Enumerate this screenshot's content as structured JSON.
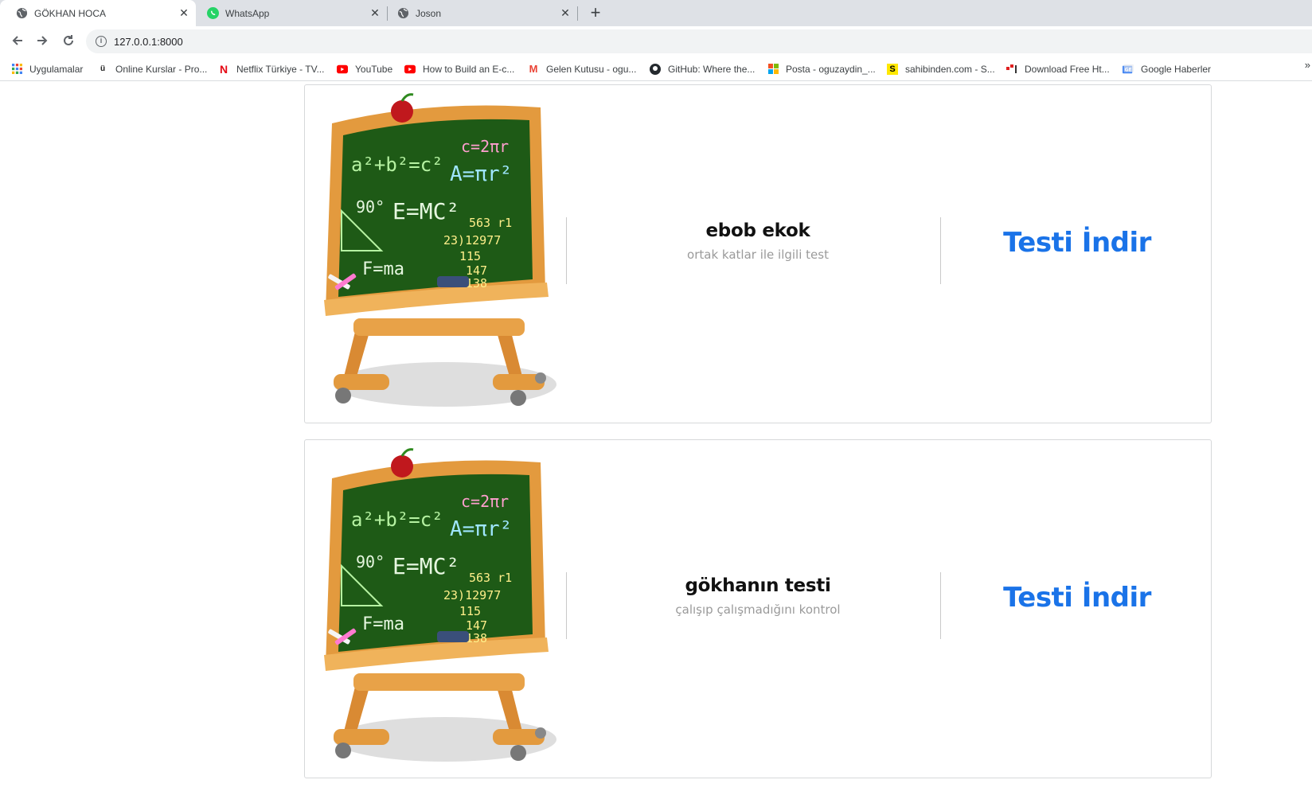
{
  "browser": {
    "tabs": [
      {
        "title": "GÖKHAN HOCA",
        "icon": "globe-icon"
      },
      {
        "title": "WhatsApp",
        "icon": "whatsapp-icon"
      },
      {
        "title": "Joson",
        "icon": "globe-icon"
      }
    ],
    "url": "127.0.0.1:8000",
    "bookmarks": [
      {
        "label": "Uygulamalar",
        "icon": "apps-grid-icon"
      },
      {
        "label": "Online Kurslar - Pro...",
        "icon": "udemy-icon"
      },
      {
        "label": "Netflix Türkiye - TV...",
        "icon": "netflix-icon"
      },
      {
        "label": "YouTube",
        "icon": "youtube-icon"
      },
      {
        "label": "How to Build an E-c...",
        "icon": "youtube-icon"
      },
      {
        "label": "Gelen Kutusu - ogu...",
        "icon": "gmail-icon"
      },
      {
        "label": "GitHub: Where the...",
        "icon": "github-icon"
      },
      {
        "label": "Posta - oguzaydin_...",
        "icon": "microsoft-icon"
      },
      {
        "label": "sahibinden.com - S...",
        "icon": "sahibinden-icon"
      },
      {
        "label": "Download Free Ht...",
        "icon": "download-site-icon"
      },
      {
        "label": "Google Haberler",
        "icon": "google-news-icon"
      }
    ],
    "more_bookmarks": "»"
  },
  "tests": [
    {
      "title": "ebob ekok",
      "description": "ortak katlar ile ilgili test",
      "download_label": "Testi İndir"
    },
    {
      "title": "gökhanın testi",
      "description": "çalışıp çalışmadığını kontrol",
      "download_label": "Testi İndir"
    }
  ],
  "colors": {
    "download_link": "#1a73e8",
    "chalkboard": "#1e5a16",
    "frame": "#e39a3e"
  }
}
